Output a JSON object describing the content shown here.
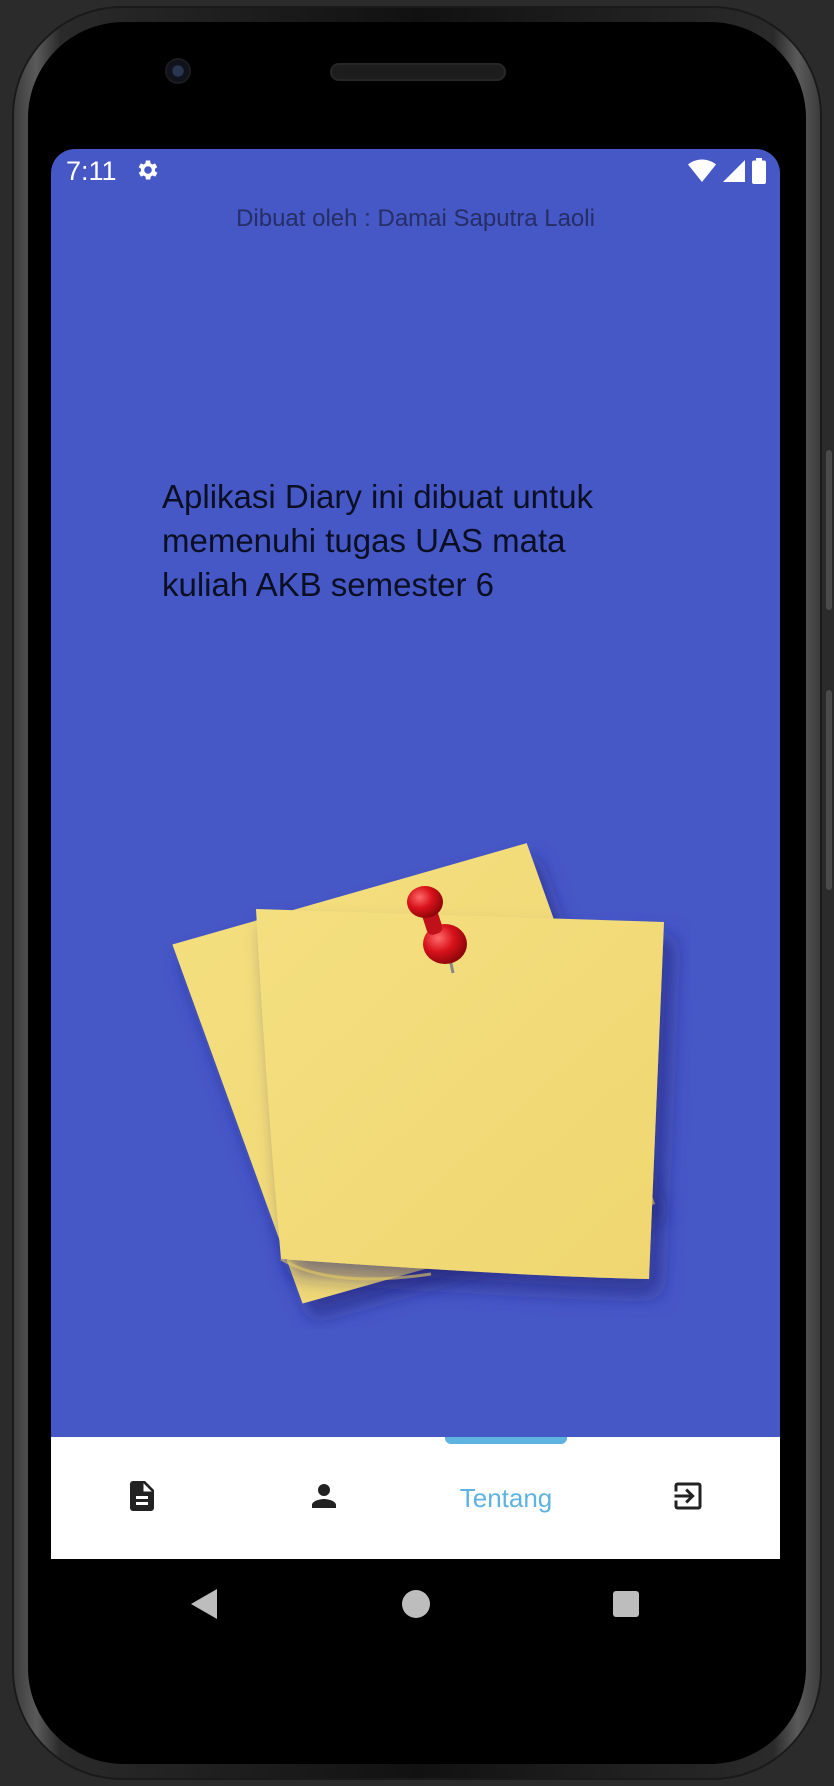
{
  "status_bar": {
    "time": "7:11",
    "icons": [
      "settings-gear-icon",
      "wifi-icon",
      "cell-signal-icon",
      "battery-icon"
    ]
  },
  "credit_line": "Dibuat oleh : Damai Saputra Laoli",
  "about": {
    "description": "Aplikasi Diary ini dibuat untuk memenuhi tugas UAS mata kuliah AKB semester 6"
  },
  "illustration": "sticky-notes-with-pushpin",
  "bottom_nav": {
    "items": [
      {
        "icon": "document-icon",
        "label": ""
      },
      {
        "icon": "person-icon",
        "label": ""
      },
      {
        "icon": "",
        "label": "Tentang"
      },
      {
        "icon": "logout-icon",
        "label": ""
      }
    ],
    "active_index": 2
  },
  "system_nav": [
    "back-icon",
    "home-icon",
    "recents-icon"
  ],
  "colors": {
    "background": "#4657c6",
    "accent": "#5fb3e0",
    "note_yellow": "#f2dc7a",
    "pin_red": "#d8121b"
  }
}
